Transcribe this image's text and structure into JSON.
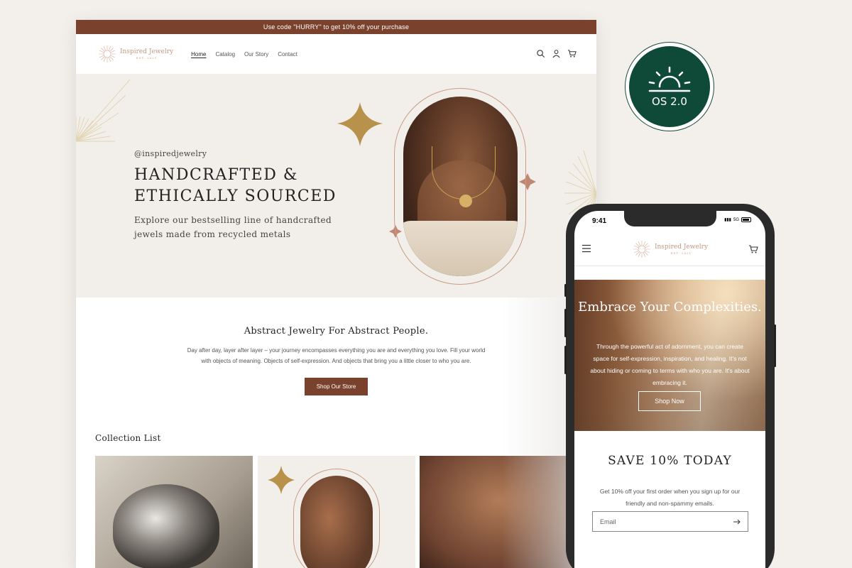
{
  "announcement": "Use code \"HURRY\" to get 10% off your purchase",
  "brand": {
    "name": "Inspired Jewelry",
    "tagline": "EST. 2021"
  },
  "nav": {
    "links": [
      "Home",
      "Catalog",
      "Our Story",
      "Contact"
    ],
    "active": "Home"
  },
  "hero": {
    "handle": "@inspiredjewelry",
    "title": "HANDCRAFTED & ETHICALLY SOURCED",
    "subtitle": "Explore our bestselling line of handcrafted jewels made from recycled metals"
  },
  "about": {
    "title": "Abstract Jewelry For Abstract People.",
    "text": "Day after day, layer after layer – your journey encompasses everything you are and everything you love. Fill your world with objects of meaning. Objects of self-expression. And objects that bring you a little closer to who you are.",
    "button": "Shop Our Store"
  },
  "collection": {
    "title": "Collection List"
  },
  "badge": {
    "label": "OS 2.0"
  },
  "mobile": {
    "time": "9:41",
    "network": "5G",
    "hero_title": "Embrace Your Complexities.",
    "hero_text": "Through the powerful act of adornment, you can create space for self-expression, inspiration, and healing. It's not about hiding or coming to terms with who you are. It's about embracing it.",
    "hero_button": "Shop Now",
    "save_title": "SAVE 10% TODAY",
    "save_text": "Get 10% off your first order when you sign up for our friendly and non-spammy emails.",
    "email_placeholder": "Email"
  },
  "colors": {
    "accent": "#7a422c",
    "badge": "#0f4a38",
    "hero_bg": "#f2efeb",
    "gold": "#b8914a"
  }
}
